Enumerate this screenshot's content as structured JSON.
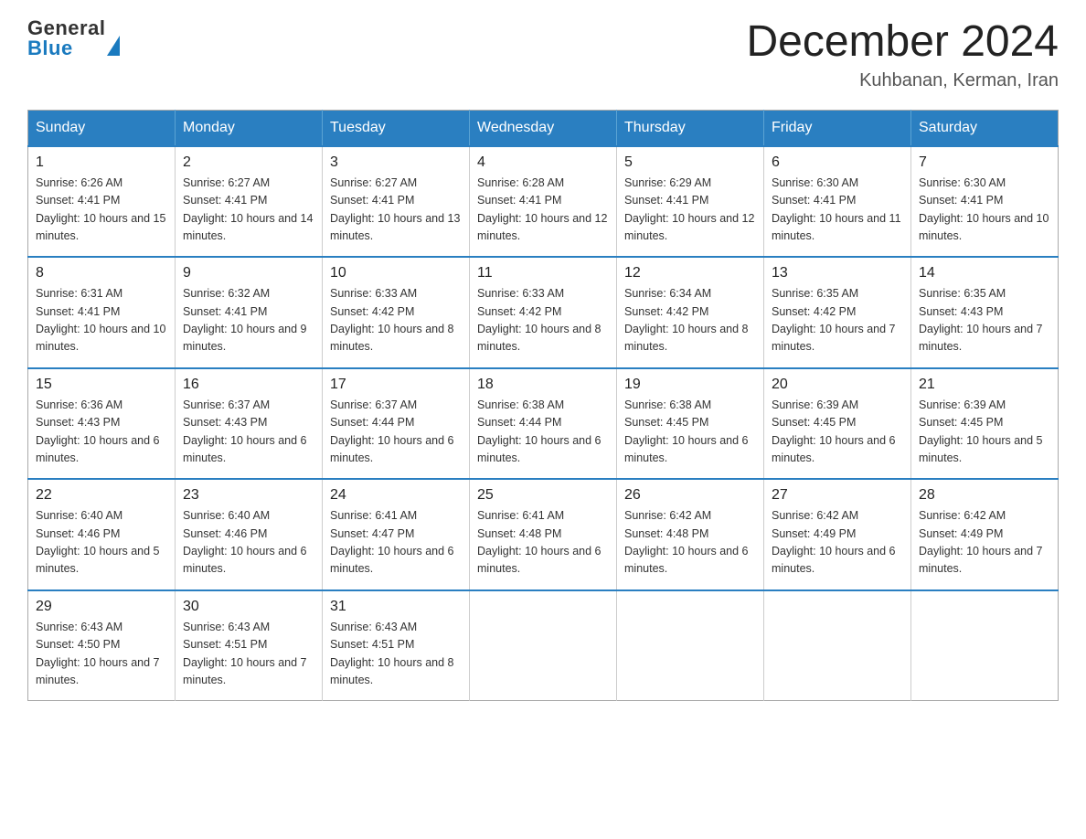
{
  "header": {
    "logo_general": "General",
    "logo_blue": "Blue",
    "month_title": "December 2024",
    "location": "Kuhbanan, Kerman, Iran"
  },
  "calendar": {
    "days_of_week": [
      "Sunday",
      "Monday",
      "Tuesday",
      "Wednesday",
      "Thursday",
      "Friday",
      "Saturday"
    ],
    "weeks": [
      [
        {
          "day": "1",
          "sunrise": "Sunrise: 6:26 AM",
          "sunset": "Sunset: 4:41 PM",
          "daylight": "Daylight: 10 hours and 15 minutes."
        },
        {
          "day": "2",
          "sunrise": "Sunrise: 6:27 AM",
          "sunset": "Sunset: 4:41 PM",
          "daylight": "Daylight: 10 hours and 14 minutes."
        },
        {
          "day": "3",
          "sunrise": "Sunrise: 6:27 AM",
          "sunset": "Sunset: 4:41 PM",
          "daylight": "Daylight: 10 hours and 13 minutes."
        },
        {
          "day": "4",
          "sunrise": "Sunrise: 6:28 AM",
          "sunset": "Sunset: 4:41 PM",
          "daylight": "Daylight: 10 hours and 12 minutes."
        },
        {
          "day": "5",
          "sunrise": "Sunrise: 6:29 AM",
          "sunset": "Sunset: 4:41 PM",
          "daylight": "Daylight: 10 hours and 12 minutes."
        },
        {
          "day": "6",
          "sunrise": "Sunrise: 6:30 AM",
          "sunset": "Sunset: 4:41 PM",
          "daylight": "Daylight: 10 hours and 11 minutes."
        },
        {
          "day": "7",
          "sunrise": "Sunrise: 6:30 AM",
          "sunset": "Sunset: 4:41 PM",
          "daylight": "Daylight: 10 hours and 10 minutes."
        }
      ],
      [
        {
          "day": "8",
          "sunrise": "Sunrise: 6:31 AM",
          "sunset": "Sunset: 4:41 PM",
          "daylight": "Daylight: 10 hours and 10 minutes."
        },
        {
          "day": "9",
          "sunrise": "Sunrise: 6:32 AM",
          "sunset": "Sunset: 4:41 PM",
          "daylight": "Daylight: 10 hours and 9 minutes."
        },
        {
          "day": "10",
          "sunrise": "Sunrise: 6:33 AM",
          "sunset": "Sunset: 4:42 PM",
          "daylight": "Daylight: 10 hours and 8 minutes."
        },
        {
          "day": "11",
          "sunrise": "Sunrise: 6:33 AM",
          "sunset": "Sunset: 4:42 PM",
          "daylight": "Daylight: 10 hours and 8 minutes."
        },
        {
          "day": "12",
          "sunrise": "Sunrise: 6:34 AM",
          "sunset": "Sunset: 4:42 PM",
          "daylight": "Daylight: 10 hours and 8 minutes."
        },
        {
          "day": "13",
          "sunrise": "Sunrise: 6:35 AM",
          "sunset": "Sunset: 4:42 PM",
          "daylight": "Daylight: 10 hours and 7 minutes."
        },
        {
          "day": "14",
          "sunrise": "Sunrise: 6:35 AM",
          "sunset": "Sunset: 4:43 PM",
          "daylight": "Daylight: 10 hours and 7 minutes."
        }
      ],
      [
        {
          "day": "15",
          "sunrise": "Sunrise: 6:36 AM",
          "sunset": "Sunset: 4:43 PM",
          "daylight": "Daylight: 10 hours and 6 minutes."
        },
        {
          "day": "16",
          "sunrise": "Sunrise: 6:37 AM",
          "sunset": "Sunset: 4:43 PM",
          "daylight": "Daylight: 10 hours and 6 minutes."
        },
        {
          "day": "17",
          "sunrise": "Sunrise: 6:37 AM",
          "sunset": "Sunset: 4:44 PM",
          "daylight": "Daylight: 10 hours and 6 minutes."
        },
        {
          "day": "18",
          "sunrise": "Sunrise: 6:38 AM",
          "sunset": "Sunset: 4:44 PM",
          "daylight": "Daylight: 10 hours and 6 minutes."
        },
        {
          "day": "19",
          "sunrise": "Sunrise: 6:38 AM",
          "sunset": "Sunset: 4:45 PM",
          "daylight": "Daylight: 10 hours and 6 minutes."
        },
        {
          "day": "20",
          "sunrise": "Sunrise: 6:39 AM",
          "sunset": "Sunset: 4:45 PM",
          "daylight": "Daylight: 10 hours and 6 minutes."
        },
        {
          "day": "21",
          "sunrise": "Sunrise: 6:39 AM",
          "sunset": "Sunset: 4:45 PM",
          "daylight": "Daylight: 10 hours and 5 minutes."
        }
      ],
      [
        {
          "day": "22",
          "sunrise": "Sunrise: 6:40 AM",
          "sunset": "Sunset: 4:46 PM",
          "daylight": "Daylight: 10 hours and 5 minutes."
        },
        {
          "day": "23",
          "sunrise": "Sunrise: 6:40 AM",
          "sunset": "Sunset: 4:46 PM",
          "daylight": "Daylight: 10 hours and 6 minutes."
        },
        {
          "day": "24",
          "sunrise": "Sunrise: 6:41 AM",
          "sunset": "Sunset: 4:47 PM",
          "daylight": "Daylight: 10 hours and 6 minutes."
        },
        {
          "day": "25",
          "sunrise": "Sunrise: 6:41 AM",
          "sunset": "Sunset: 4:48 PM",
          "daylight": "Daylight: 10 hours and 6 minutes."
        },
        {
          "day": "26",
          "sunrise": "Sunrise: 6:42 AM",
          "sunset": "Sunset: 4:48 PM",
          "daylight": "Daylight: 10 hours and 6 minutes."
        },
        {
          "day": "27",
          "sunrise": "Sunrise: 6:42 AM",
          "sunset": "Sunset: 4:49 PM",
          "daylight": "Daylight: 10 hours and 6 minutes."
        },
        {
          "day": "28",
          "sunrise": "Sunrise: 6:42 AM",
          "sunset": "Sunset: 4:49 PM",
          "daylight": "Daylight: 10 hours and 7 minutes."
        }
      ],
      [
        {
          "day": "29",
          "sunrise": "Sunrise: 6:43 AM",
          "sunset": "Sunset: 4:50 PM",
          "daylight": "Daylight: 10 hours and 7 minutes."
        },
        {
          "day": "30",
          "sunrise": "Sunrise: 6:43 AM",
          "sunset": "Sunset: 4:51 PM",
          "daylight": "Daylight: 10 hours and 7 minutes."
        },
        {
          "day": "31",
          "sunrise": "Sunrise: 6:43 AM",
          "sunset": "Sunset: 4:51 PM",
          "daylight": "Daylight: 10 hours and 8 minutes."
        },
        null,
        null,
        null,
        null
      ]
    ]
  }
}
